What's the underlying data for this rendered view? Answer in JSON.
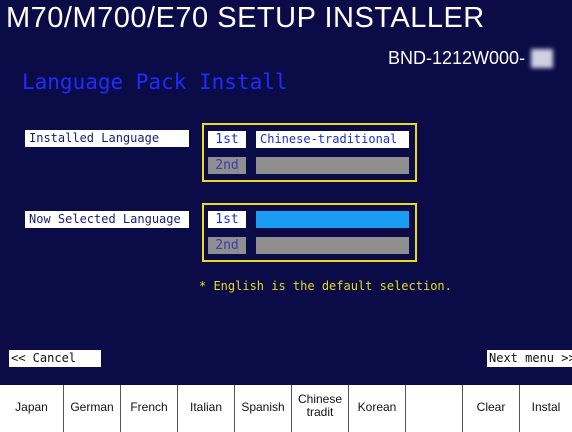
{
  "header": {
    "title": "M70/M700/E70 SETUP INSTALLER",
    "version": "BND-1212W000-"
  },
  "section": {
    "title": "Language Pack Install"
  },
  "installed": {
    "label": "Installed Language",
    "rows": [
      {
        "rank": "1st",
        "value": "Chinese-traditional"
      },
      {
        "rank": "2nd",
        "value": ""
      }
    ]
  },
  "selected": {
    "label": "Now Selected Language",
    "rows": [
      {
        "rank": "1st",
        "value": ""
      },
      {
        "rank": "2nd",
        "value": ""
      }
    ]
  },
  "note": "* English is the default selection.",
  "nav": {
    "cancel": "<< Cancel",
    "next": "Next menu >>"
  },
  "softkeys": [
    {
      "label": "Japan"
    },
    {
      "label": "German"
    },
    {
      "label": "French"
    },
    {
      "label": "Italian"
    },
    {
      "label": "Spanish"
    },
    {
      "label": "Chinese tradit"
    },
    {
      "label": "Korean"
    },
    {
      "label": ""
    },
    {
      "label": "Clear"
    },
    {
      "label": "Instal"
    }
  ],
  "colors": {
    "background": "#0b0b47",
    "section_title": "#1e2dff",
    "highlight_border": "#e6dc18",
    "selected_value": "#1a9cf2",
    "inactive_field": "#8f8f8f"
  }
}
